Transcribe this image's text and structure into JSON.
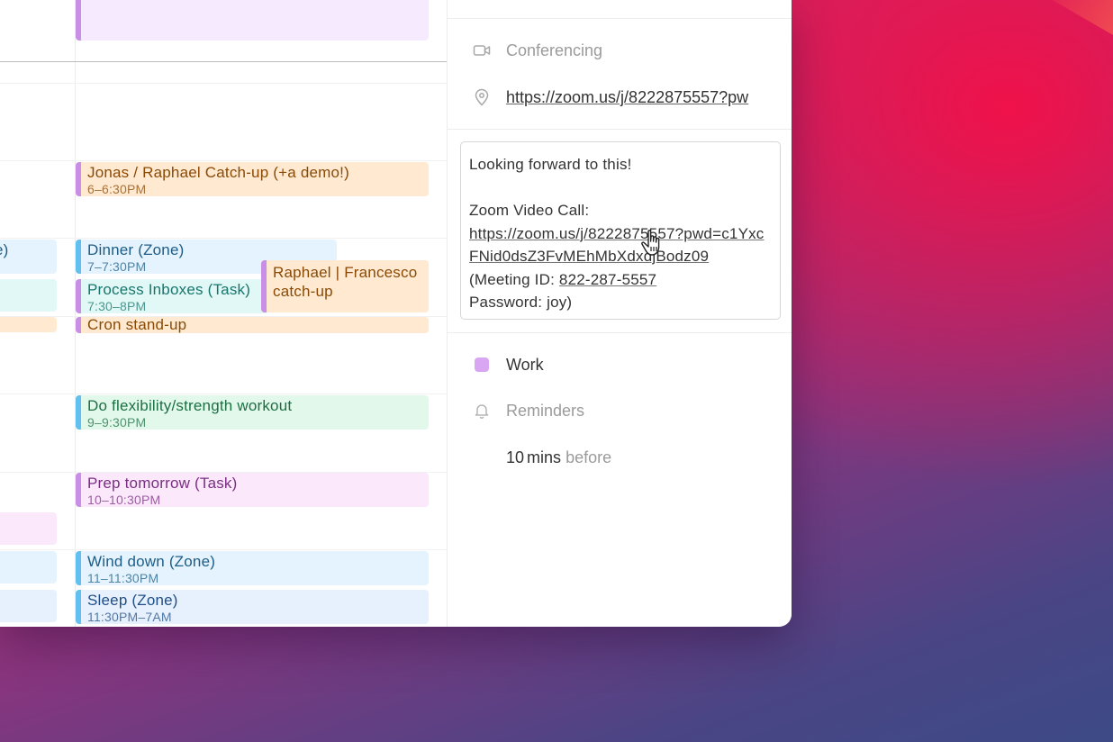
{
  "calendar": {
    "events": [
      {
        "title": "",
        "time": "",
        "color": "purple"
      },
      {
        "title": "Jonas / Raphael Catch-up (+a demo!)",
        "time": "6–6:30PM",
        "color": "orange"
      },
      {
        "title": "e)",
        "time": "",
        "color": "blue"
      },
      {
        "title": "Dinner (Zone)",
        "time": "7–7:30PM",
        "color": "blue"
      },
      {
        "title": "Raphael | Francesco catch-up",
        "time": "",
        "color": "orange"
      },
      {
        "title": "",
        "time": "",
        "color": "teal"
      },
      {
        "title": "Process Inboxes (Task)",
        "time": "7:30–8PM",
        "color": "teal"
      },
      {
        "title": "",
        "time": "",
        "color": "orange"
      },
      {
        "title": "Cron stand-up",
        "time": "",
        "color": "orange"
      },
      {
        "title": "Do flexibility/strength workout",
        "time": "9–9:30PM",
        "color": "green"
      },
      {
        "title": "Prep tomorrow (Task)",
        "time": "10–10:30PM",
        "color": "pink"
      },
      {
        "title": "",
        "time": "",
        "color": "pink"
      },
      {
        "title": "",
        "time": "",
        "color": "blue"
      },
      {
        "title": "Wind down (Zone)",
        "time": "11–11:30PM",
        "color": "blue"
      },
      {
        "title": "",
        "time": "",
        "color": "lblue"
      },
      {
        "title": "Sleep (Zone)",
        "time": "11:30PM–7AM",
        "color": "lblue"
      }
    ]
  },
  "details": {
    "conferencing_label": "Conferencing",
    "conferencing_icon": "video-camera-icon",
    "location_icon": "map-pin-icon",
    "location_url": "https://zoom.us/j/8222875557?pw",
    "description": {
      "line1": "Looking forward to this!",
      "line2": "Zoom Video Call:",
      "link": "https://zoom.us/j/8222875557?pwd=c1YxcFNid0dsZ3FvMEhMbXdxdjBodz09",
      "meeting_id_prefix": " (Meeting ID: ",
      "meeting_id": "822-287-5557",
      "meeting_id_suffix": "",
      "password": "Password: joy)"
    },
    "calendar_name": "Work",
    "calendar_color": "#d8a6f3",
    "reminders_label": "Reminders",
    "reminders_icon": "bell-icon",
    "reminder_value": "10",
    "reminder_unit": "mins",
    "reminder_suffix": "before"
  }
}
